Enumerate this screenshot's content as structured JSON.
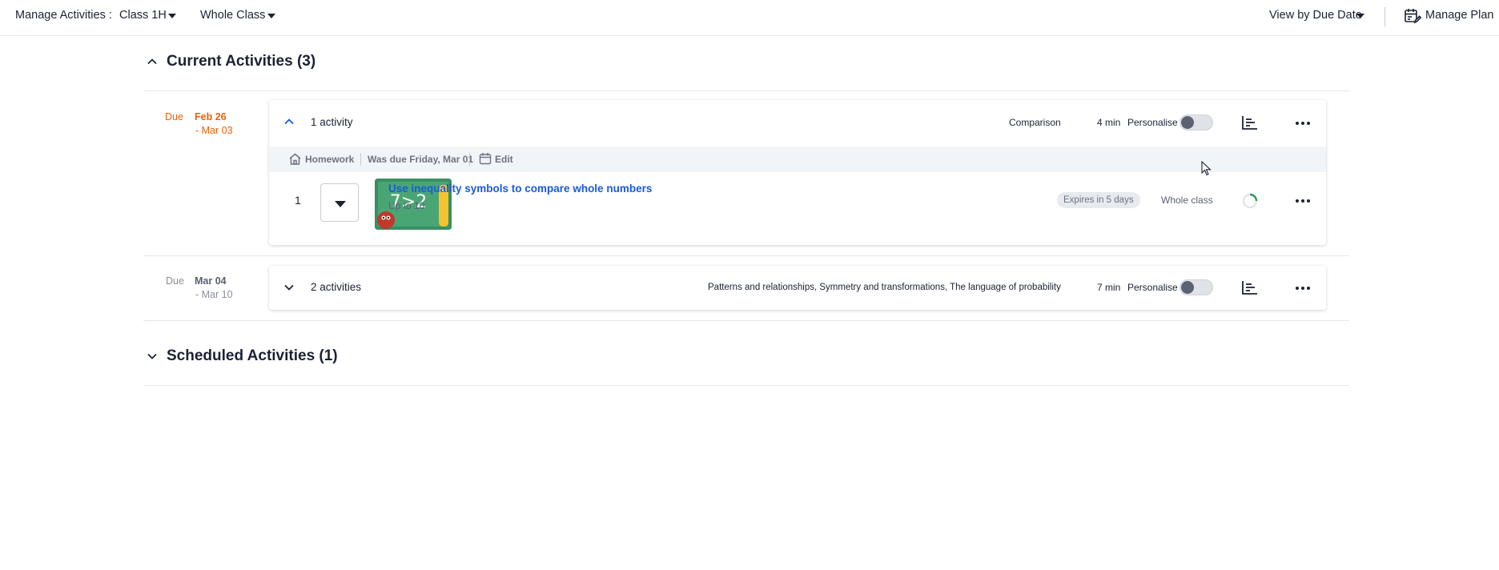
{
  "topbar": {
    "manage_label": "Manage Activities :",
    "class_value": "Class 1H",
    "group_value": "Whole Class",
    "view_label": "View by Due Date",
    "manage_plan_label": "Manage Plan"
  },
  "current_section": {
    "title": "Current Activities (3)",
    "groups": [
      {
        "due_label": "Due",
        "due_from": "Feb 26",
        "due_to": "- Mar 03",
        "count_label": "1 activity",
        "topic": "Comparison",
        "duration": "4 min",
        "personalise_label": "Personalise",
        "personalise_on": false,
        "detail": {
          "type_label": "Homework",
          "was_due": "Was due Friday, Mar 01",
          "edit_label": "Edit",
          "activities": [
            {
              "index": "1",
              "title": "Use inequality symbols to compare whole numbers",
              "subtitle": "Up to 10",
              "thumb_text": "7>2",
              "expires": "Expires in 5 days",
              "audience": "Whole class"
            }
          ]
        }
      },
      {
        "due_label": "Due",
        "due_from": "Mar 04",
        "due_to": "- Mar 10",
        "count_label": "2 activities",
        "topic": "Patterns and relationships, Symmetry and transformations, The language of probability",
        "duration": "7 min",
        "personalise_label": "Personalise",
        "personalise_on": false
      }
    ]
  },
  "scheduled_section": {
    "title": "Scheduled Activities (1)"
  },
  "colors": {
    "due_current": "#e8620a",
    "due_upcoming": "#8a8f99",
    "link": "#1b5bd6",
    "text": "#1c2233"
  },
  "icons": [
    "chevron-down-icon",
    "chevron-up-icon",
    "calendar-edit-icon",
    "home-icon",
    "calendar-icon",
    "bar-chart-icon",
    "more-icon",
    "caret-down-icon",
    "progress-ring-icon",
    "cursor-icon"
  ]
}
